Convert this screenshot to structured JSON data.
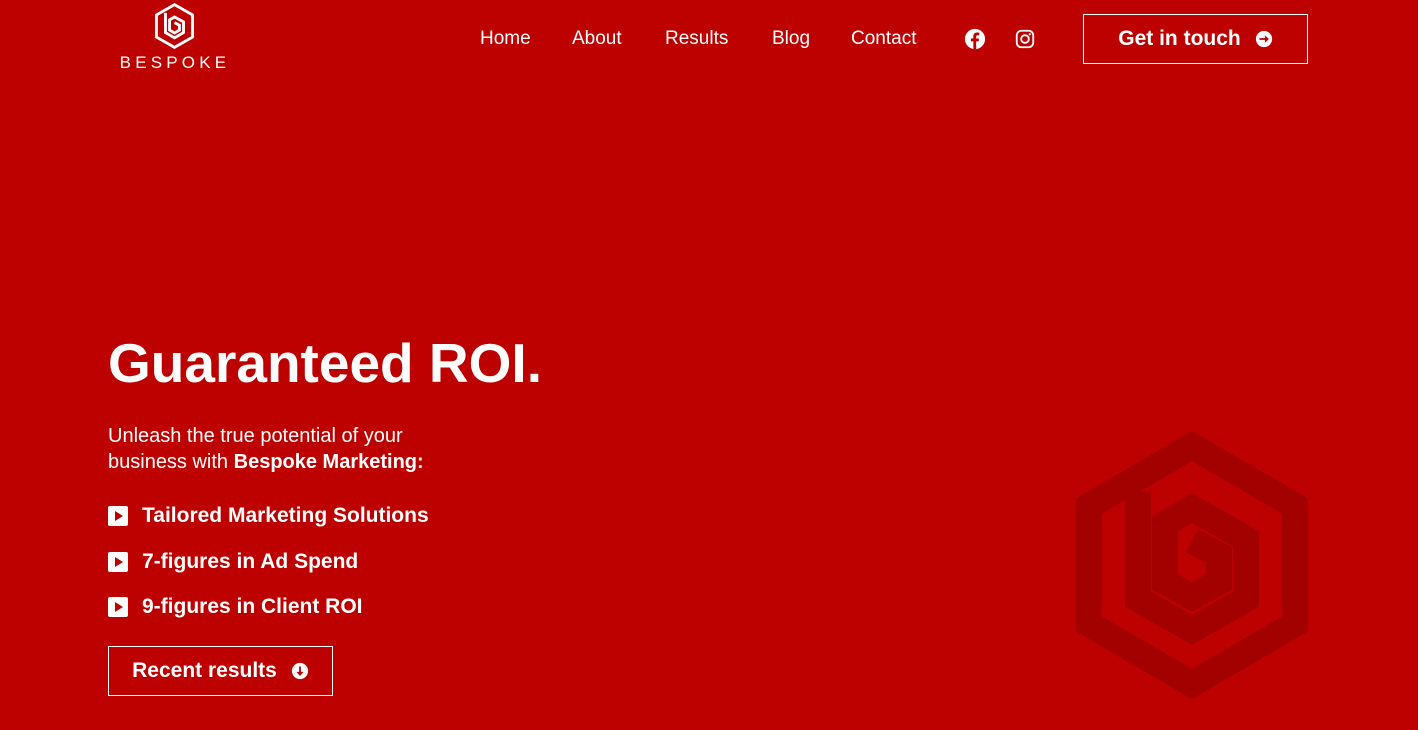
{
  "brand": {
    "name": "BESPOKE"
  },
  "nav": {
    "items": [
      {
        "label": "Home"
      },
      {
        "label": "About"
      },
      {
        "label": "Results"
      },
      {
        "label": "Blog"
      },
      {
        "label": "Contact"
      }
    ],
    "social": [
      "facebook-icon",
      "instagram-icon"
    ],
    "cta_label": "Get in touch"
  },
  "hero": {
    "title": "Guaranteed ROI.",
    "subtitle_line1": "Unleash the true potential of your",
    "subtitle_line2_prefix": "business with ",
    "subtitle_line2_bold": "Bespoke Marketing:",
    "features": [
      {
        "label": "Tailored Marketing Solutions"
      },
      {
        "label": "7-figures in Ad Spend"
      },
      {
        "label": "9-figures in Client ROI"
      }
    ],
    "button_label": "Recent results"
  },
  "colors": {
    "background": "#bd0000",
    "watermark": "#a30000",
    "text": "#ffffff"
  }
}
